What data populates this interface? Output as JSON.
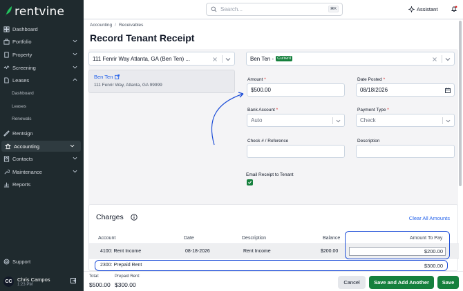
{
  "brand": {
    "name": "rentvine"
  },
  "sidebar": {
    "items": [
      {
        "label": "Dashboard",
        "icon": "dashboard-icon"
      },
      {
        "label": "Portfolio",
        "icon": "portfolio-icon"
      },
      {
        "label": "Property",
        "icon": "building-icon"
      },
      {
        "label": "Screening",
        "icon": "screening-icon"
      },
      {
        "label": "Leases",
        "icon": "file-icon"
      },
      {
        "label": "Dashboard",
        "icon": ""
      },
      {
        "label": "Leases",
        "icon": ""
      },
      {
        "label": "Renewals",
        "icon": ""
      },
      {
        "label": "Rentsign",
        "icon": "signature-icon"
      },
      {
        "label": "Accounting",
        "icon": "bank-icon"
      },
      {
        "label": "Contacts",
        "icon": "contacts-icon"
      },
      {
        "label": "Maintenance",
        "icon": "wrench-icon"
      },
      {
        "label": "Reports",
        "icon": "chart-icon"
      },
      {
        "label": "Support",
        "icon": "support-icon"
      }
    ],
    "user": {
      "initials": "CC",
      "name": "Chris Campos",
      "time": "1:23 PM"
    }
  },
  "topbar": {
    "search_placeholder": "Search...",
    "search_shortcut": "⌘K",
    "assistant_label": "Assistant"
  },
  "breadcrumb": [
    "Accounting",
    "Receivables"
  ],
  "page_title": "Record Tenant Receipt",
  "form": {
    "property_select": "111 Fenrir Way Atlanta, GA (Ben Ten) ...",
    "tenant_select": "Ben Ten -",
    "tenant_badge": "Current",
    "card_name": "Ben Ten",
    "card_address": "111 Fenrir Way, Atlanta, GA 99999",
    "amount_label": "Amount",
    "amount_value": "$500.00",
    "date_label": "Date Posted",
    "date_value": "08/18/2026",
    "bank_label": "Bank Account",
    "bank_value": "Auto",
    "payment_label": "Payment Type",
    "payment_value": "Check",
    "check_label": "Check # / Reference",
    "check_value": "",
    "desc_label": "Description",
    "desc_value": "",
    "email_label": "Email Receipt to Tenant",
    "email_checked": true
  },
  "charges": {
    "title": "Charges",
    "clear_label": "Clear All Amounts",
    "columns": [
      "Account",
      "Date",
      "Description",
      "Balance",
      "Amount To Pay"
    ],
    "rows": [
      {
        "account": "4100: Rent Income",
        "date": "08-18-2026",
        "description": "Rent Income",
        "balance": "$200.00",
        "amount": "$200.00"
      }
    ],
    "prepaid": {
      "account": "2300: Prepaid Rent",
      "amount": "$300.00"
    }
  },
  "footer": {
    "total_label": "Total:",
    "total_value": "$500.00",
    "prepaid_label": "Prepaid Rent:",
    "prepaid_value": "$300.00",
    "cancel_label": "Cancel",
    "save_add_label": "Save and Add Another",
    "save_label": "Save"
  },
  "colors": {
    "accent_green": "#15803d",
    "link_blue": "#2563eb",
    "sidebar_bg": "#1f2a2e",
    "highlight": "#1d4ed8"
  }
}
